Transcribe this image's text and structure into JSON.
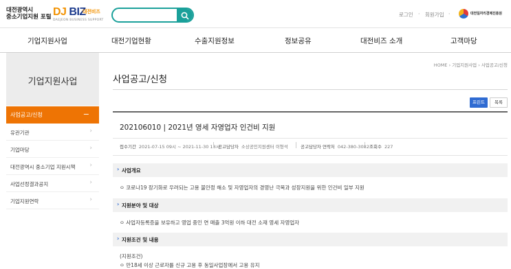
{
  "header": {
    "logo_line1": "대전광역시",
    "logo_line2": "중소기업지원 포털",
    "brand_dj": "DJ",
    "brand_biz": "BIZ",
    "brand_sub": "대전비즈",
    "brand_en": "DAEJEON BUSINESS SUPPORT",
    "search_placeholder": "",
    "login": "로그인",
    "join": "회원가입",
    "agency": "대전일자리경제진흥원"
  },
  "gnb": [
    {
      "label": "기업지원사업"
    },
    {
      "label": "대전기업현황"
    },
    {
      "label": "수출지원정보"
    },
    {
      "label": "정보공유"
    },
    {
      "label": "대전비즈 소개"
    },
    {
      "label": "고객마당"
    }
  ],
  "lnb": {
    "title": "기업지원사업",
    "active": "사업공고/신청",
    "items": [
      {
        "label": "유관기관"
      },
      {
        "label": "기업마당"
      },
      {
        "label": "대전광역시 중소기업 지원시책"
      },
      {
        "label": "사업선정결과공지"
      },
      {
        "label": "기업지원연락"
      }
    ]
  },
  "breadcrumb": {
    "home": "HOME",
    "level1": "기업지원사업",
    "level2": "사업공고/신청"
  },
  "page": {
    "title": "사업공고/신청",
    "print_button": "프린트",
    "list_button": "목록"
  },
  "post": {
    "title": "202106010 | 2021년 영세 자영업자 인건비 지원",
    "period_label": "접수기간",
    "period_value": "2021-07-15 09시 ~ 2021-11-30 18시",
    "manager_label": "공고담당자",
    "manager_value": "소상공인지원센터 이형석",
    "contact_label": "공고담당자 연락처",
    "contact_value": "042-380-3082",
    "views_label": "조회수",
    "views_value": "227"
  },
  "sections": [
    {
      "heading": "사업개요",
      "body": "ㅇ 코로나19 장기화로 우려되는 고용 불안정 해소 및 자영업자의 경영난 극복과 성장지원을 위한 인건비 일부 지원"
    },
    {
      "heading": "지원분야 및 대상",
      "body": "ㅇ 사업자등록증을 보유하고 영업 중인 연 매출 3억원 이하 대전 소재 영세 자영업자"
    },
    {
      "heading": "지원조건 및 내용",
      "body": "(지원조건)",
      "body2": "ㅇ 만18세 이상 근로자를 신규 고용 후 동일사업장에서 고용 유지"
    }
  ],
  "colors": {
    "accent_orange": "#ee7404",
    "accent_teal": "#1aa09a",
    "button_blue": "#2f6bd2"
  }
}
